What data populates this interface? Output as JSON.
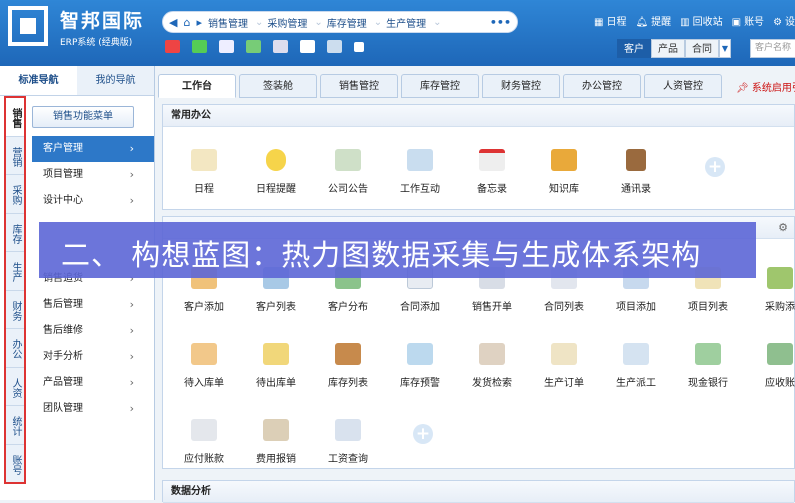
{
  "header": {
    "brand_title": "智邦国际",
    "brand_subtitle": "ERP系统 (经典版)",
    "nav_menu": [
      "销售管理",
      "采购管理",
      "库存管理",
      "生产管理"
    ],
    "top_links": [
      "日程",
      "提醒",
      "回收站",
      "账号",
      "设"
    ],
    "search_tabs": [
      "客户",
      "产品",
      "合同"
    ],
    "search_placeholder": "客户名称"
  },
  "left_nav": {
    "tabs": [
      "标准导航",
      "我的导航"
    ],
    "vertical_tabs": [
      "销售",
      "营销",
      "采购",
      "库存",
      "生产",
      "财务",
      "办公",
      "人资",
      "统计",
      "账号"
    ],
    "menu_button": "销售功能菜单",
    "menu_items": [
      "客户管理",
      "项目管理",
      "设计中心",
      "销售追货",
      "售后管理",
      "售后维修",
      "对手分析",
      "产品管理",
      "团队管理"
    ]
  },
  "main": {
    "tabs": [
      "工作台",
      "签装舱",
      "销售管控",
      "库存管控",
      "财务管控",
      "办公管控",
      "人资管控"
    ],
    "system_note": "系统启用引",
    "panel1_title": "常用办公",
    "panel1_items": [
      "日程",
      "日程提醒",
      "公司公告",
      "工作互动",
      "备忘录",
      "知识库",
      "通讯录"
    ],
    "panel2_row1": [
      "客户添加",
      "客户列表",
      "客户分布",
      "合同添加",
      "销售开单",
      "合同列表",
      "项目添加",
      "项目列表",
      "采购添"
    ],
    "panel2_row2": [
      "待入库单",
      "待出库单",
      "库存列表",
      "库存预警",
      "发货检索",
      "生产订单",
      "生产派工",
      "现金银行",
      "应收账"
    ],
    "panel2_row3": [
      "应付账款",
      "费用报销",
      "工资查询"
    ],
    "panel3_title": "数据分析"
  },
  "banner": "二、 构想蓝图：热力图数据采集与生成体系架构",
  "colors": {
    "header_blue": "#1e67b8",
    "active_blue": "#2d78c8",
    "banner": "#5c66d6",
    "highlight_red": "#dd3333"
  }
}
